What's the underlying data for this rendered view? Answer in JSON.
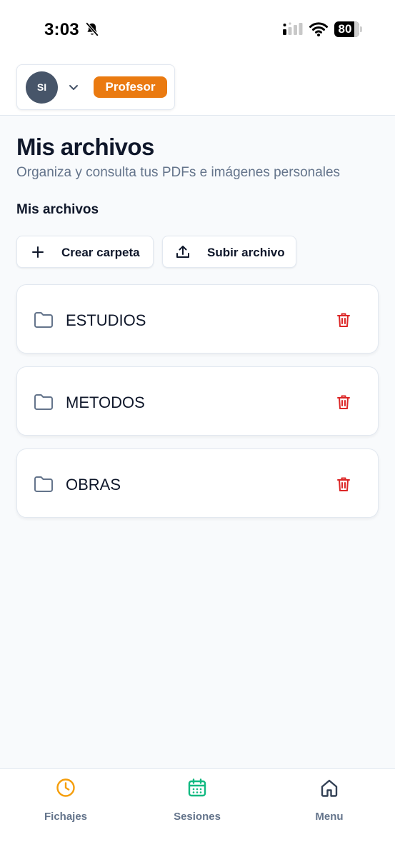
{
  "status_bar": {
    "time": "3:03",
    "battery_level": "80",
    "battery_fraction": 0.8,
    "icons": [
      "bell-slash-icon",
      "signal-icon",
      "wifi-icon",
      "battery-icon"
    ]
  },
  "header": {
    "avatar_initials": "SI",
    "role_label": "Profesor",
    "colors": {
      "role_badge": "#ea7a10",
      "avatar": "#475569"
    }
  },
  "page": {
    "title": "Mis archivos",
    "subtitle": "Organiza y consulta tus PDFs e imágenes personales",
    "section_title": "Mis archivos"
  },
  "actions": {
    "create_folder": {
      "label": "Crear carpeta",
      "icon": "plus-icon"
    },
    "upload_file": {
      "label": "Subir archivo",
      "icon": "upload-icon"
    }
  },
  "folders": [
    {
      "name": "ESTUDIOS",
      "icon": "folder-icon",
      "action_icon": "trash-icon"
    },
    {
      "name": "METODOS",
      "icon": "folder-icon",
      "action_icon": "trash-icon"
    },
    {
      "name": "OBRAS",
      "icon": "folder-icon",
      "action_icon": "trash-icon"
    }
  ],
  "bottom_nav": {
    "items": [
      {
        "label": "Fichajes",
        "icon": "clock-icon",
        "color": "#f59e0b"
      },
      {
        "label": "Sesiones",
        "icon": "calendar-icon",
        "color": "#10b981"
      },
      {
        "label": "Menu",
        "icon": "home-icon",
        "color": "#475569"
      }
    ]
  },
  "colors": {
    "danger": "#dc2626",
    "text_primary": "#0f172a",
    "text_muted": "#64748b",
    "background": "#f8fafc"
  }
}
